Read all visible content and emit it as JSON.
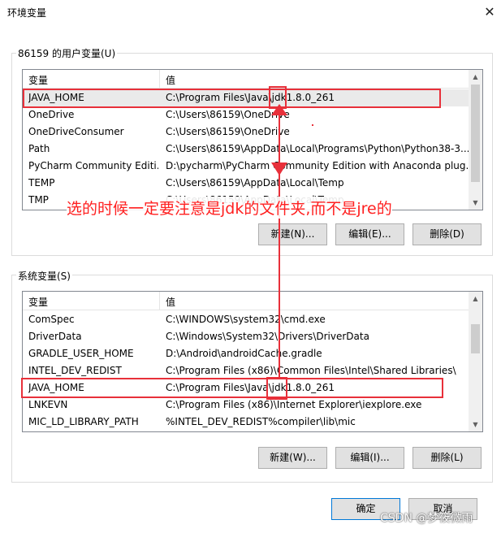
{
  "window": {
    "title": "环境变量",
    "close_label": "✕"
  },
  "user_vars": {
    "group_label": "86159 的用户变量(U)",
    "col_name": "变量",
    "col_value": "值",
    "rows": [
      {
        "name": "JAVA_HOME",
        "value": "C:\\Program Files\\Java\\jdk1.8.0_261"
      },
      {
        "name": "OneDrive",
        "value": "C:\\Users\\86159\\OneDrive"
      },
      {
        "name": "OneDriveConsumer",
        "value": "C:\\Users\\86159\\OneDrive"
      },
      {
        "name": "Path",
        "value": "C:\\Users\\86159\\AppData\\Local\\Programs\\Python\\Python38-3..."
      },
      {
        "name": "PyCharm Community Editi...",
        "value": "D:\\pycharm\\PyCharm Community Edition with Anaconda plug..."
      },
      {
        "name": "TEMP",
        "value": "C:\\Users\\86159\\AppData\\Local\\Temp"
      },
      {
        "name": "TMP",
        "value": "C:\\Users\\86159\\AppData\\Local\\Temp"
      }
    ],
    "new_button": "新建(N)...",
    "edit_button": "编辑(E)...",
    "delete_button": "删除(D)"
  },
  "system_vars": {
    "group_label": "系统变量(S)",
    "col_name": "变量",
    "col_value": "值",
    "rows": [
      {
        "name": "ComSpec",
        "value": "C:\\WINDOWS\\system32\\cmd.exe"
      },
      {
        "name": "DriverData",
        "value": "C:\\Windows\\System32\\Drivers\\DriverData"
      },
      {
        "name": "GRADLE_USER_HOME",
        "value": "D:\\Android\\androidCache.gradle"
      },
      {
        "name": "INTEL_DEV_REDIST",
        "value": "C:\\Program Files (x86)\\Common Files\\Intel\\Shared Libraries\\"
      },
      {
        "name": "JAVA_HOME",
        "value": "C:\\Program Files\\Java\\jdk1.8.0_261"
      },
      {
        "name": "LNKEVN",
        "value": "C:\\Program Files (x86)\\Internet Explorer\\iexplore.exe"
      },
      {
        "name": "MIC_LD_LIBRARY_PATH",
        "value": "%INTEL_DEV_REDIST%compiler\\lib\\mic"
      }
    ],
    "new_button": "新建(W)...",
    "edit_button": "编辑(I)...",
    "delete_button": "删除(L)"
  },
  "footer": {
    "ok_button": "确定",
    "cancel_button": "取消"
  },
  "annotation_text": "选的时候一定要注意是jdk的文件夹,而不是jre的",
  "watermark": "CSDN @梦筱微雨",
  "colors": {
    "annotation_red": "#e8303a",
    "selected_row": "#eaeaea",
    "default_button_border": "#0078d7"
  }
}
